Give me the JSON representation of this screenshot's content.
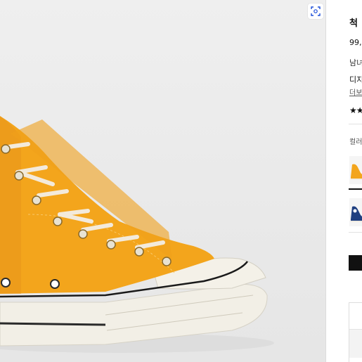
{
  "gallery": {
    "image_subject": "shoe-photo",
    "zoom_icon": "expand-icon",
    "upper_color": "#f3a51c",
    "sole_color": "#f1ede3"
  },
  "product": {
    "title": "척 ",
    "price": "99,",
    "gender": "남녀",
    "design_label": "디지",
    "more_link": "더보",
    "stars": "★★",
    "color_label": "컬러"
  },
  "colors": {
    "swatches": [
      {
        "name": "yellow",
        "hex": "#f3a51c",
        "selected": true
      },
      {
        "name": "navy",
        "hex": "#1f3f80",
        "selected": false
      }
    ]
  }
}
